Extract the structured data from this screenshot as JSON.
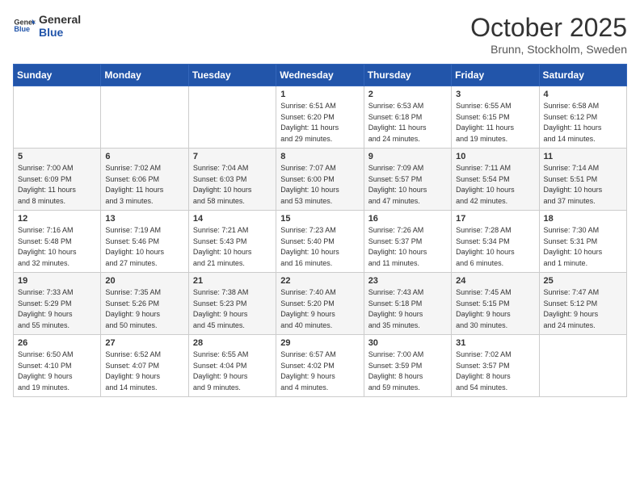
{
  "header": {
    "logo_general": "General",
    "logo_blue": "Blue",
    "month_title": "October 2025",
    "location": "Brunn, Stockholm, Sweden"
  },
  "weekdays": [
    "Sunday",
    "Monday",
    "Tuesday",
    "Wednesday",
    "Thursday",
    "Friday",
    "Saturday"
  ],
  "weeks": [
    [
      {
        "day": "",
        "info": ""
      },
      {
        "day": "",
        "info": ""
      },
      {
        "day": "",
        "info": ""
      },
      {
        "day": "1",
        "info": "Sunrise: 6:51 AM\nSunset: 6:20 PM\nDaylight: 11 hours\nand 29 minutes."
      },
      {
        "day": "2",
        "info": "Sunrise: 6:53 AM\nSunset: 6:18 PM\nDaylight: 11 hours\nand 24 minutes."
      },
      {
        "day": "3",
        "info": "Sunrise: 6:55 AM\nSunset: 6:15 PM\nDaylight: 11 hours\nand 19 minutes."
      },
      {
        "day": "4",
        "info": "Sunrise: 6:58 AM\nSunset: 6:12 PM\nDaylight: 11 hours\nand 14 minutes."
      }
    ],
    [
      {
        "day": "5",
        "info": "Sunrise: 7:00 AM\nSunset: 6:09 PM\nDaylight: 11 hours\nand 8 minutes."
      },
      {
        "day": "6",
        "info": "Sunrise: 7:02 AM\nSunset: 6:06 PM\nDaylight: 11 hours\nand 3 minutes."
      },
      {
        "day": "7",
        "info": "Sunrise: 7:04 AM\nSunset: 6:03 PM\nDaylight: 10 hours\nand 58 minutes."
      },
      {
        "day": "8",
        "info": "Sunrise: 7:07 AM\nSunset: 6:00 PM\nDaylight: 10 hours\nand 53 minutes."
      },
      {
        "day": "9",
        "info": "Sunrise: 7:09 AM\nSunset: 5:57 PM\nDaylight: 10 hours\nand 47 minutes."
      },
      {
        "day": "10",
        "info": "Sunrise: 7:11 AM\nSunset: 5:54 PM\nDaylight: 10 hours\nand 42 minutes."
      },
      {
        "day": "11",
        "info": "Sunrise: 7:14 AM\nSunset: 5:51 PM\nDaylight: 10 hours\nand 37 minutes."
      }
    ],
    [
      {
        "day": "12",
        "info": "Sunrise: 7:16 AM\nSunset: 5:48 PM\nDaylight: 10 hours\nand 32 minutes."
      },
      {
        "day": "13",
        "info": "Sunrise: 7:19 AM\nSunset: 5:46 PM\nDaylight: 10 hours\nand 27 minutes."
      },
      {
        "day": "14",
        "info": "Sunrise: 7:21 AM\nSunset: 5:43 PM\nDaylight: 10 hours\nand 21 minutes."
      },
      {
        "day": "15",
        "info": "Sunrise: 7:23 AM\nSunset: 5:40 PM\nDaylight: 10 hours\nand 16 minutes."
      },
      {
        "day": "16",
        "info": "Sunrise: 7:26 AM\nSunset: 5:37 PM\nDaylight: 10 hours\nand 11 minutes."
      },
      {
        "day": "17",
        "info": "Sunrise: 7:28 AM\nSunset: 5:34 PM\nDaylight: 10 hours\nand 6 minutes."
      },
      {
        "day": "18",
        "info": "Sunrise: 7:30 AM\nSunset: 5:31 PM\nDaylight: 10 hours\nand 1 minute."
      }
    ],
    [
      {
        "day": "19",
        "info": "Sunrise: 7:33 AM\nSunset: 5:29 PM\nDaylight: 9 hours\nand 55 minutes."
      },
      {
        "day": "20",
        "info": "Sunrise: 7:35 AM\nSunset: 5:26 PM\nDaylight: 9 hours\nand 50 minutes."
      },
      {
        "day": "21",
        "info": "Sunrise: 7:38 AM\nSunset: 5:23 PM\nDaylight: 9 hours\nand 45 minutes."
      },
      {
        "day": "22",
        "info": "Sunrise: 7:40 AM\nSunset: 5:20 PM\nDaylight: 9 hours\nand 40 minutes."
      },
      {
        "day": "23",
        "info": "Sunrise: 7:43 AM\nSunset: 5:18 PM\nDaylight: 9 hours\nand 35 minutes."
      },
      {
        "day": "24",
        "info": "Sunrise: 7:45 AM\nSunset: 5:15 PM\nDaylight: 9 hours\nand 30 minutes."
      },
      {
        "day": "25",
        "info": "Sunrise: 7:47 AM\nSunset: 5:12 PM\nDaylight: 9 hours\nand 24 minutes."
      }
    ],
    [
      {
        "day": "26",
        "info": "Sunrise: 6:50 AM\nSunset: 4:10 PM\nDaylight: 9 hours\nand 19 minutes."
      },
      {
        "day": "27",
        "info": "Sunrise: 6:52 AM\nSunset: 4:07 PM\nDaylight: 9 hours\nand 14 minutes."
      },
      {
        "day": "28",
        "info": "Sunrise: 6:55 AM\nSunset: 4:04 PM\nDaylight: 9 hours\nand 9 minutes."
      },
      {
        "day": "29",
        "info": "Sunrise: 6:57 AM\nSunset: 4:02 PM\nDaylight: 9 hours\nand 4 minutes."
      },
      {
        "day": "30",
        "info": "Sunrise: 7:00 AM\nSunset: 3:59 PM\nDaylight: 8 hours\nand 59 minutes."
      },
      {
        "day": "31",
        "info": "Sunrise: 7:02 AM\nSunset: 3:57 PM\nDaylight: 8 hours\nand 54 minutes."
      },
      {
        "day": "",
        "info": ""
      }
    ]
  ]
}
